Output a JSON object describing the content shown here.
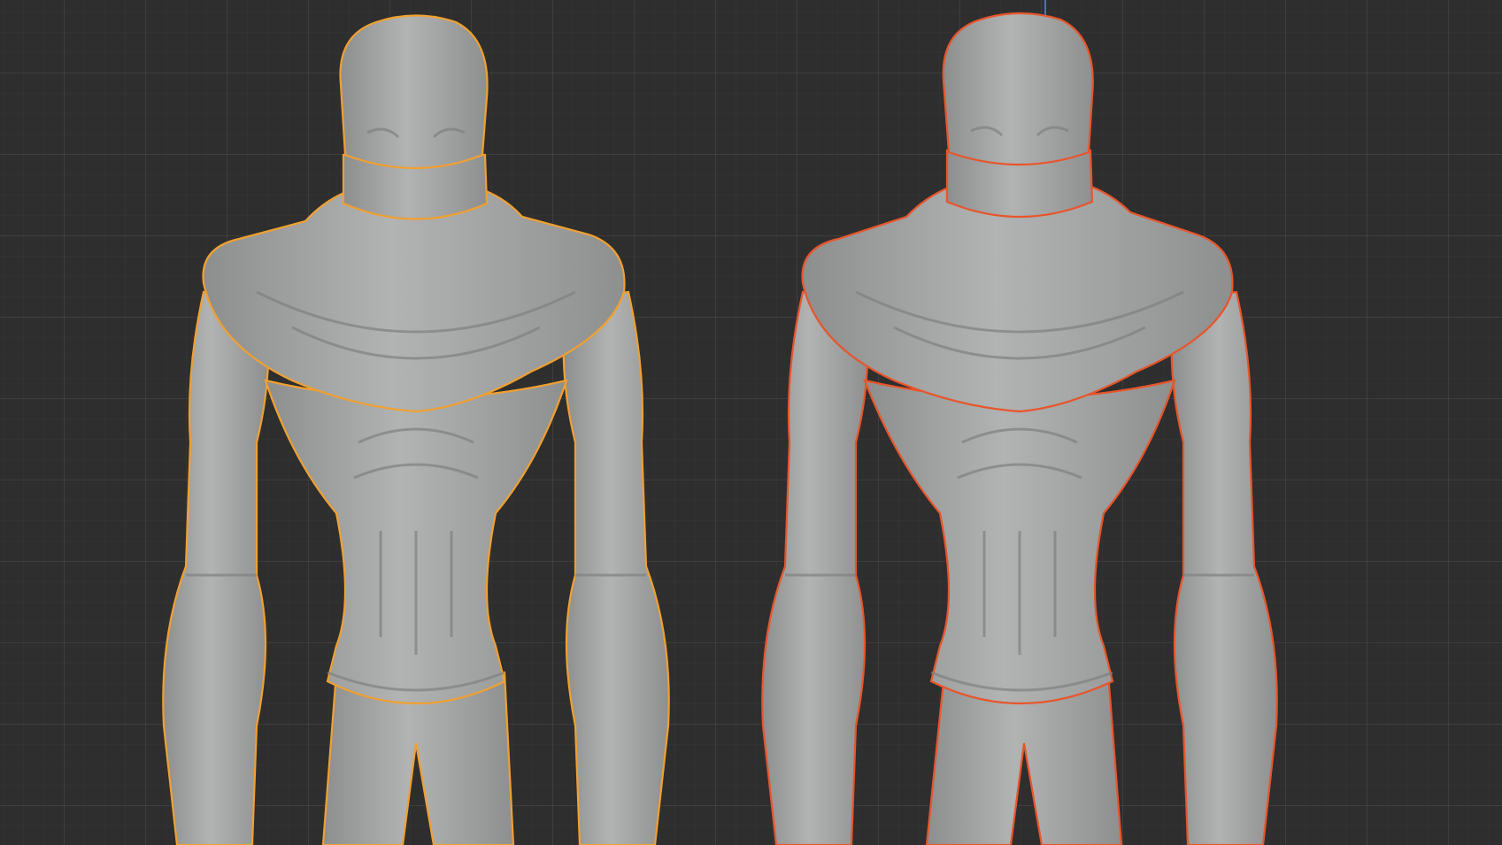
{
  "viewport": {
    "background": "#2e2e2e",
    "grid_color": "#3a3a3a",
    "z_axis_color": "#4f6fc0"
  },
  "models": [
    {
      "name": "character-model-left",
      "outline_color": "#f0a030",
      "state": "selected"
    },
    {
      "name": "character-model-right",
      "outline_color": "#e8552a",
      "state": "selected-active"
    }
  ],
  "mesh_color": "#a9aaaa"
}
